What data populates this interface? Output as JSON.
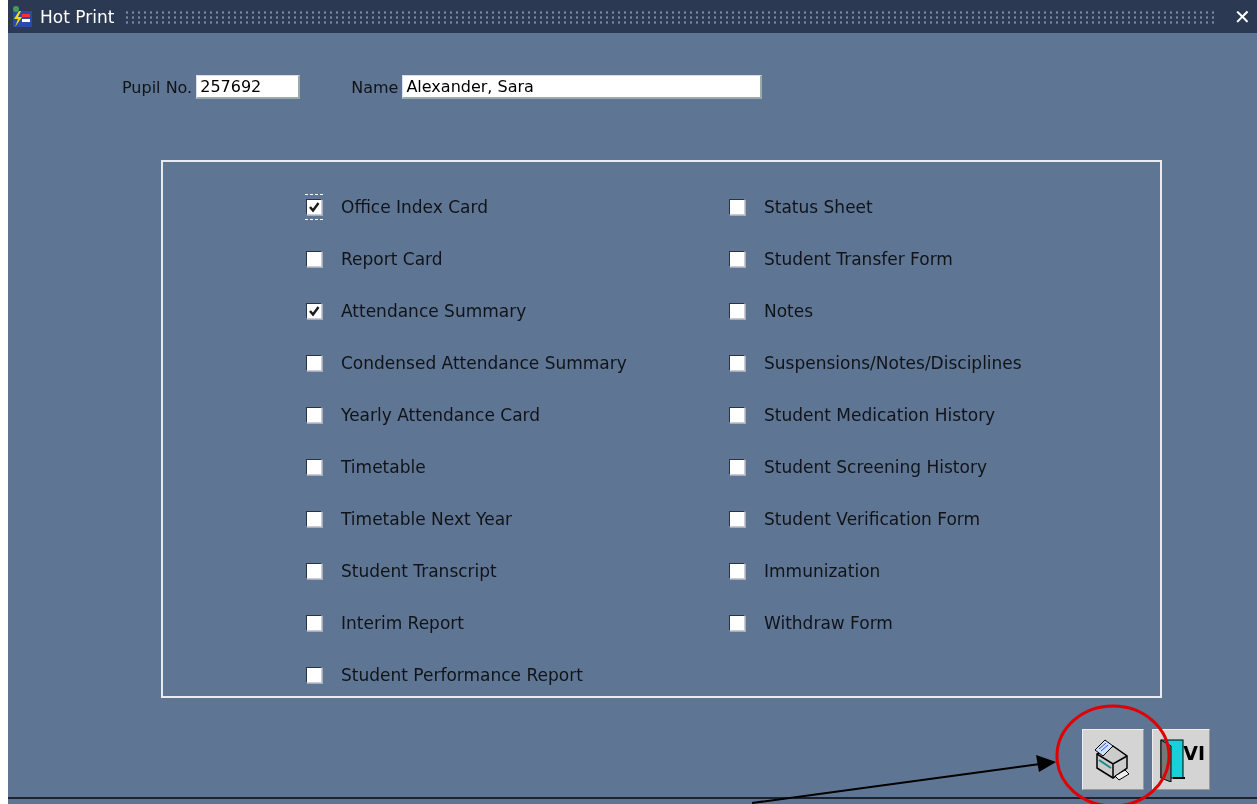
{
  "window": {
    "title": "Hot Print",
    "close": "✕"
  },
  "fields": [
    {
      "label": "Pupil No.",
      "value": "257692"
    },
    {
      "label": "Name",
      "value": "Alexander, Sara"
    }
  ],
  "reports_left": [
    {
      "label": "Office Index Card",
      "checked": true,
      "focused": true
    },
    {
      "label": "Report Card",
      "checked": false,
      "focused": false
    },
    {
      "label": "Attendance Summary",
      "checked": true,
      "focused": false
    },
    {
      "label": "Condensed Attendance Summary",
      "checked": false,
      "focused": false
    },
    {
      "label": "Yearly Attendance Card",
      "checked": false,
      "focused": false
    },
    {
      "label": "Timetable",
      "checked": false,
      "focused": false
    },
    {
      "label": "Timetable Next Year",
      "checked": false,
      "focused": false
    },
    {
      "label": "Student Transcript",
      "checked": false,
      "focused": false
    },
    {
      "label": "Interim Report",
      "checked": false,
      "focused": false
    },
    {
      "label": "Student Performance Report",
      "checked": false,
      "focused": false
    }
  ],
  "reports_right": [
    {
      "label": "Status Sheet",
      "checked": false,
      "focused": false
    },
    {
      "label": "Student Transfer Form",
      "checked": false,
      "focused": false
    },
    {
      "label": "Notes",
      "checked": false,
      "focused": false
    },
    {
      "label": "Suspensions/Notes/Disciplines",
      "checked": false,
      "focused": false
    },
    {
      "label": "Student Medication History",
      "checked": false,
      "focused": false
    },
    {
      "label": "Student Screening History",
      "checked": false,
      "focused": false
    },
    {
      "label": "Student Verification Form",
      "checked": false,
      "focused": false
    },
    {
      "label": "Immunization",
      "checked": false,
      "focused": false
    },
    {
      "label": "Withdraw Form",
      "checked": false,
      "focused": false
    }
  ],
  "buttons": [
    {
      "kind": "print"
    },
    {
      "kind": "exit",
      "text": "VI"
    }
  ]
}
